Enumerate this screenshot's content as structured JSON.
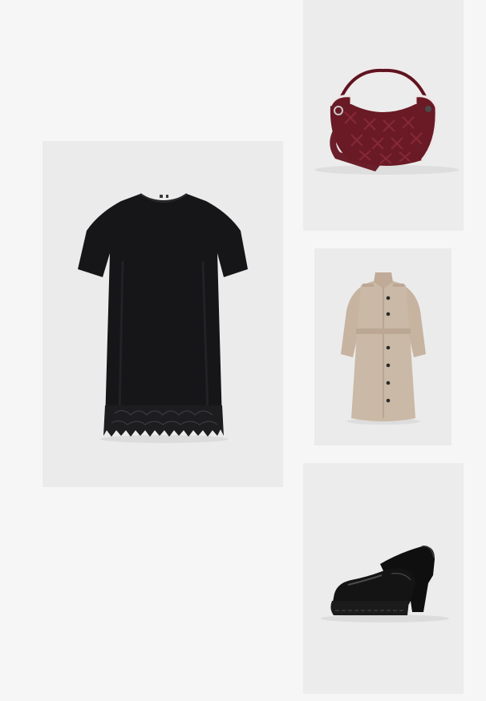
{
  "outfit": {
    "items": [
      {
        "id": "dress",
        "icon": "black-tshirt-dress-lace-hem"
      },
      {
        "id": "bag",
        "icon": "burgundy-woven-hobo-bag"
      },
      {
        "id": "coat",
        "icon": "beige-trench-coat"
      },
      {
        "id": "shoes",
        "icon": "black-platform-heeled-loafers"
      }
    ]
  },
  "colors": {
    "page_background": "#f6f6f6",
    "card_background": "#ebebeb",
    "dress": "#161618",
    "bag": "#6a1a25",
    "coat": "#c9b7a4",
    "shoes": "#101010"
  }
}
